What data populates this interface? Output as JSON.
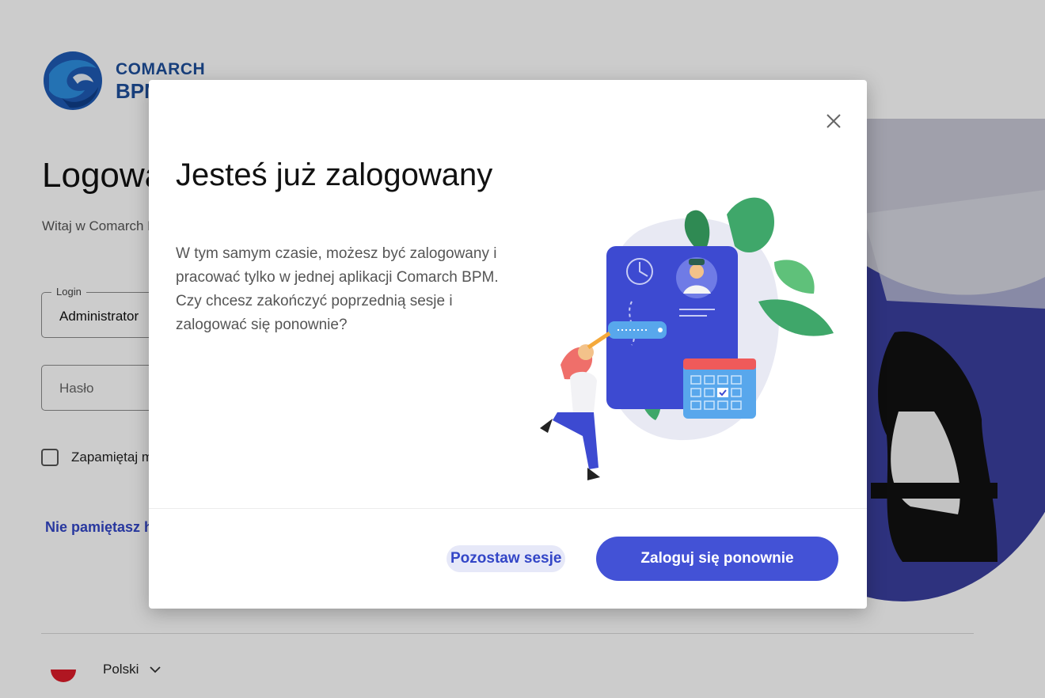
{
  "brand": {
    "line1": "COMARCH",
    "line2": "BPM",
    "color": "#1e4f9c"
  },
  "login": {
    "title": "Logowanie",
    "subtitle": "Witaj w Comarch BPM",
    "login_label": "Login",
    "login_value": "Administrator",
    "password_placeholder": "Hasło",
    "remember_label": "Zapamiętaj mnie",
    "forgot_link": "Nie pamiętasz hasła?"
  },
  "footer": {
    "language": "Polski",
    "flag_icon": "poland-flag-icon",
    "chevron_icon": "chevron-down-icon"
  },
  "modal": {
    "title": "Jesteś już zalogowany",
    "body": "W tym samym czasie, możesz być zalogowany i pracować tylko w jednej aplikacji Comarch BPM. Czy chcesz zakończyć poprzednią sesje i zalogować się ponownie?",
    "close_icon": "close-icon",
    "secondary_button": "Pozostaw sesje",
    "primary_button": "Zaloguj się ponownie"
  },
  "colors": {
    "accent": "#4352d6",
    "link": "#3346c7",
    "secondary_bg": "#e6e8f8"
  }
}
